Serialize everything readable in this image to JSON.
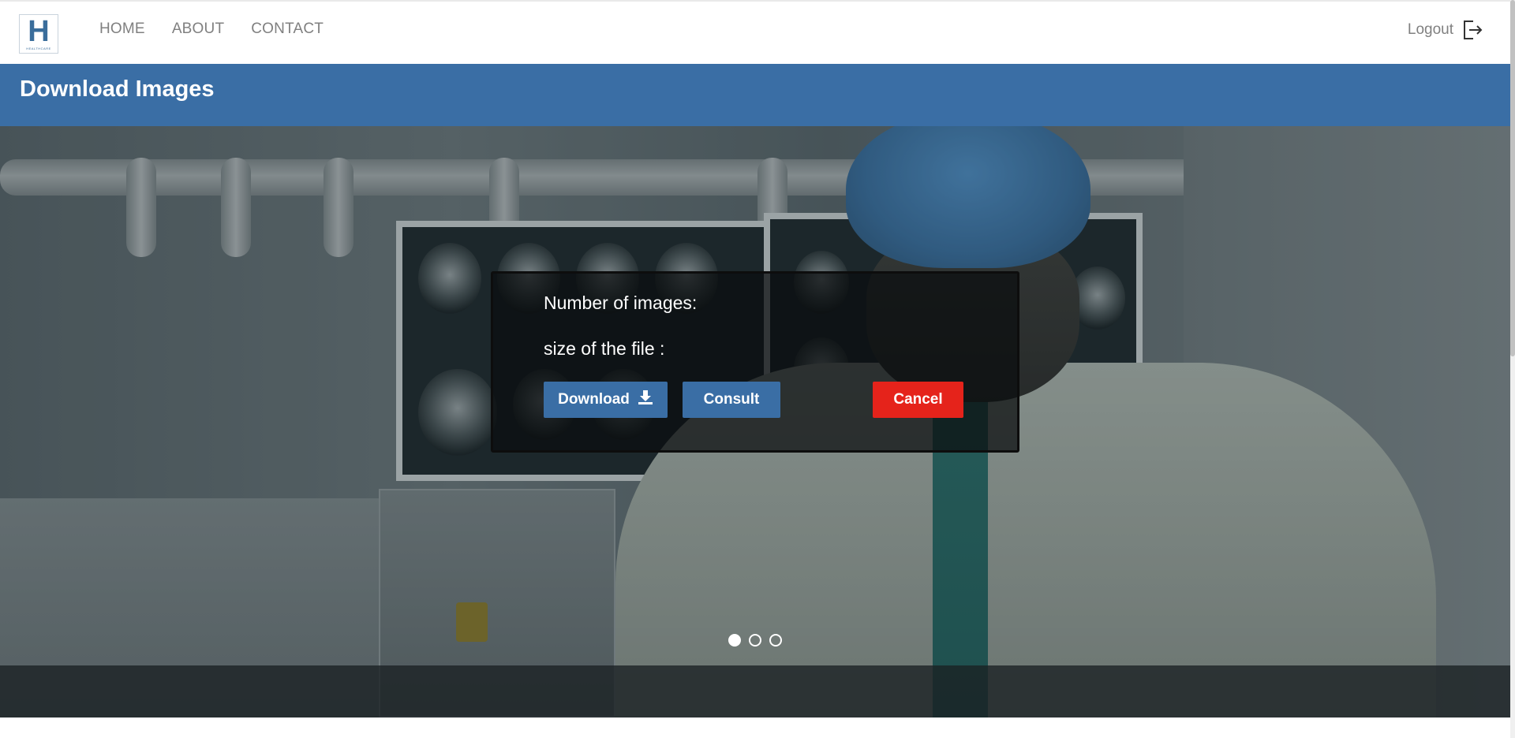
{
  "nav": {
    "logo_letter": "H",
    "logo_sub": "HEALTHCARE",
    "links": [
      "HOME",
      "ABOUT",
      "CONTACT"
    ],
    "logout_label": "Logout",
    "logout_icon": "logout-icon"
  },
  "page_title": "Download Images",
  "dialog": {
    "num_images_label": "Number of images:",
    "file_size_label": "size of the file :",
    "download_label": "Download",
    "download_icon": "download-icon",
    "consult_label": "Consult",
    "cancel_label": "Cancel"
  },
  "carousel": {
    "slide_count": 3,
    "active_index": 0
  },
  "colors": {
    "brand_blue": "#3a6ea5",
    "cancel_red": "#e5231b",
    "nav_text": "#808080"
  }
}
